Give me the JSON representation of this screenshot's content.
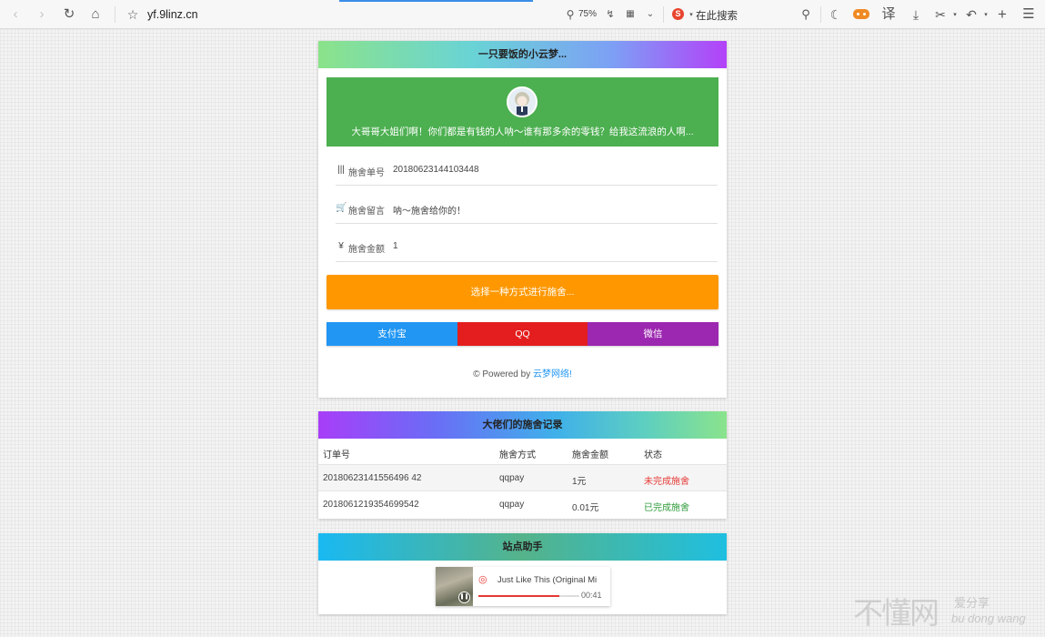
{
  "browser": {
    "url": "yf.9linz.cn",
    "zoom": "75%",
    "search_placeholder": "在此搜索",
    "translate_label": "译"
  },
  "donate_card": {
    "title": "一只要饭的小云梦...",
    "banner_text": "大哥哥大姐们啊！你们都是有钱的人呐～谁有那多余的零钱？给我这流浪的人啊...",
    "fields": [
      {
        "icon": "barcode-icon",
        "label": "施舍单号",
        "value": "20180623144103448"
      },
      {
        "icon": "cart-icon",
        "label": "施舍留言",
        "value": "呐～施舍给你的！"
      },
      {
        "icon": "yen-icon",
        "label": "施舍金额",
        "value": "1"
      }
    ],
    "choose_label": "选择一种方式进行施舍...",
    "pay_buttons": [
      {
        "label": "支付宝",
        "color": "#2196f3"
      },
      {
        "label": "QQ",
        "color": "#e41e1e"
      },
      {
        "label": "微信",
        "color": "#9c27b0"
      }
    ],
    "powered_prefix": "© Powered by ",
    "powered_link": "云梦网络!"
  },
  "records_card": {
    "title": "大佬们的施舍记录",
    "columns": [
      "订单号",
      "施舍方式",
      "施舍金额",
      "状态"
    ],
    "rows": [
      {
        "order": "20180623141556496 42",
        "method": "qqpay",
        "amount": "1元",
        "status": "未完成施舍",
        "status_color": "#e53935"
      },
      {
        "order": "2018061219354699542",
        "method": "qqpay",
        "amount": "0.01元",
        "status": "已完成施舍",
        "status_color": "#2e9b3a"
      }
    ]
  },
  "helper_card": {
    "title": "站点助手",
    "player": {
      "song": "Just Like This (Original Mi",
      "time": "00:41",
      "progress": 0.8
    }
  },
  "watermark": {
    "main": "不懂网",
    "sub_cn": "爱分享",
    "sub_pinyin": "bu dong wang"
  },
  "colors": {
    "banner": "#4caf50",
    "choose_button": "#ff9800"
  }
}
